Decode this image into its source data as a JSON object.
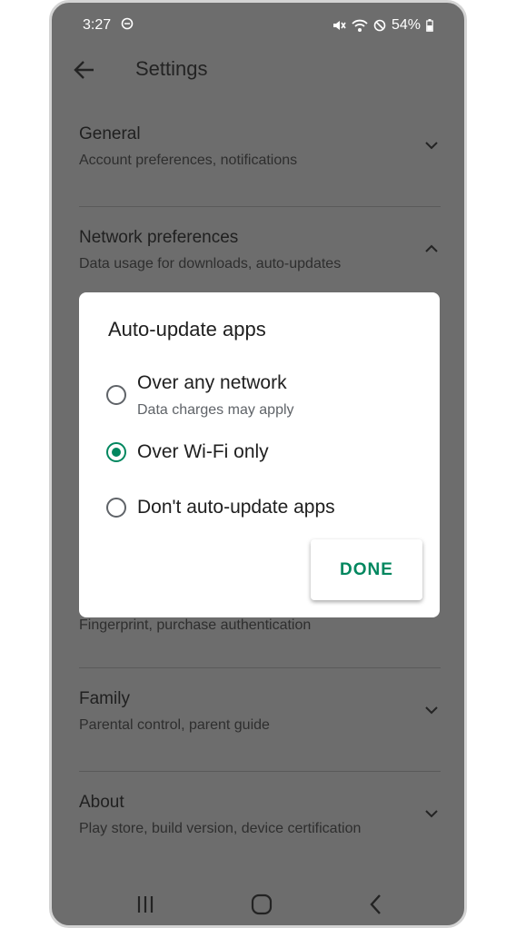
{
  "status_bar": {
    "time": "3:27",
    "battery": "54%",
    "icons": [
      "do-not-disturb-icon",
      "mute-icon",
      "wifi-icon",
      "blocked-icon",
      "battery-icon"
    ]
  },
  "app_bar": {
    "title": "Settings"
  },
  "settings": [
    {
      "title": "General",
      "subtitle": "Account preferences, notifications",
      "expanded": false
    },
    {
      "title": "Network preferences",
      "subtitle": "Data usage for downloads, auto-updates",
      "expanded": true
    },
    {
      "title": "",
      "subtitle": "Fingerprint, purchase authentication",
      "expanded": false
    },
    {
      "title": "Family",
      "subtitle": "Parental control, parent guide",
      "expanded": false
    },
    {
      "title": "About",
      "subtitle": "Play store, build version, device certification",
      "expanded": false
    }
  ],
  "dialog": {
    "title": "Auto-update apps",
    "options": [
      {
        "label": "Over any network",
        "sublabel": "Data charges may apply",
        "selected": false
      },
      {
        "label": "Over Wi-Fi only",
        "selected": true
      },
      {
        "label": "Don't auto-update apps",
        "selected": false
      }
    ],
    "done_label": "DONE"
  },
  "colors": {
    "accent": "#01875f",
    "scrim_background": "#6d6d6d",
    "dialog_background": "#ffffff"
  },
  "nav_bar": {
    "buttons": [
      "recents-icon",
      "home-icon",
      "back-icon"
    ]
  }
}
